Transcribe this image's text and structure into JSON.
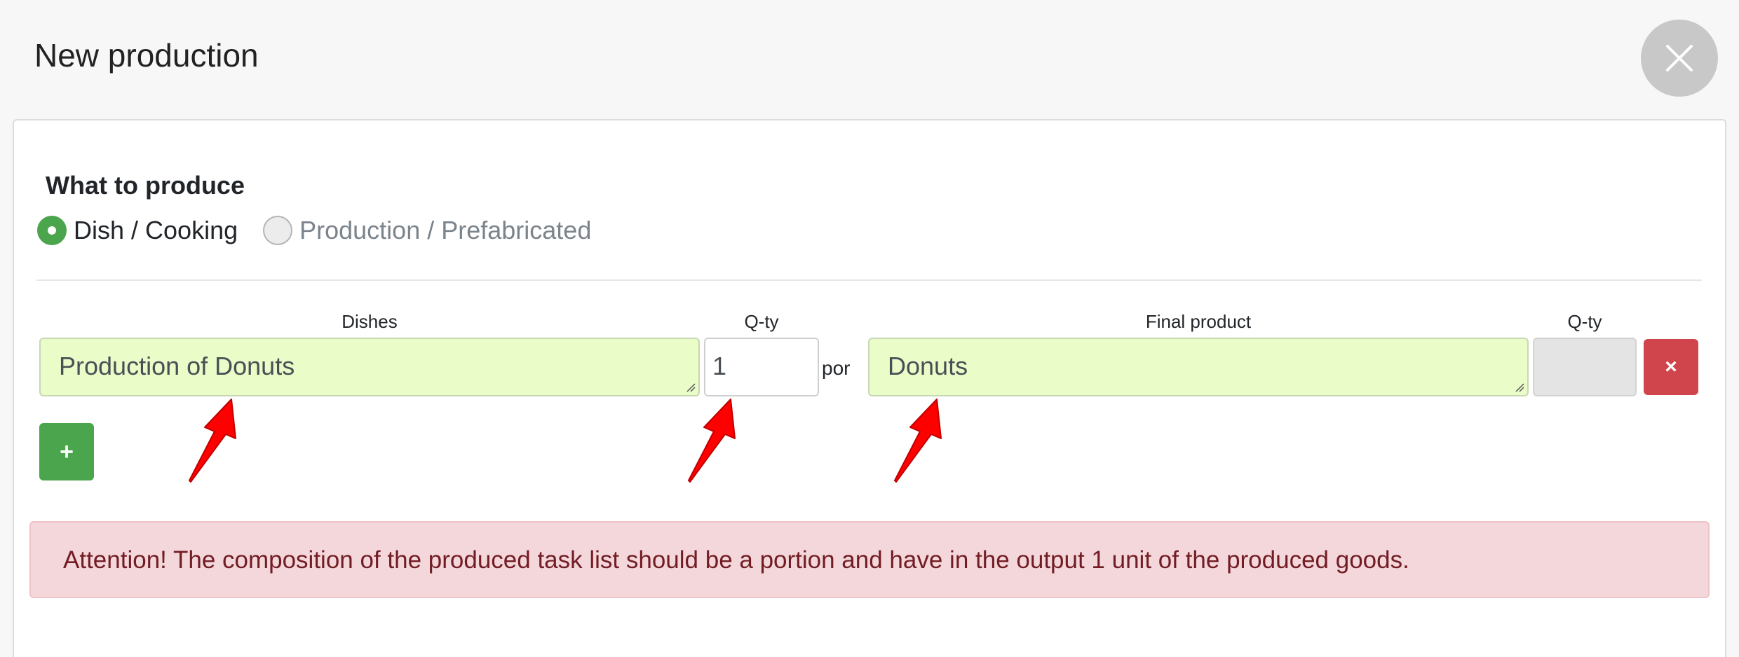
{
  "modal": {
    "title": "New production",
    "close_icon": "close-icon"
  },
  "what_to_produce": {
    "label": "What to produce",
    "options": [
      {
        "label": "Dish / Cooking",
        "selected": true
      },
      {
        "label": "Production / Prefabricated",
        "selected": false
      }
    ]
  },
  "columns": {
    "dishes": "Dishes",
    "qty_left": "Q-ty",
    "final_product": "Final product",
    "qty_right": "Q-ty"
  },
  "row": {
    "dish_value": "Production of Donuts",
    "qty_value": "1",
    "por_label": "por",
    "final_product_value": "Donuts",
    "final_qty_value": "",
    "remove_label": "×"
  },
  "add_button": {
    "label": "+"
  },
  "alert": {
    "text": "Attention! The composition of the produced task list should be a portion and have in the output 1 unit of the produced goods."
  },
  "colors": {
    "accent_green": "#4aa54d",
    "danger_red": "#d0454c",
    "field_bg": "#eafcc8",
    "alert_bg": "#f3d7da",
    "alert_text": "#721c24",
    "annotation_arrow": "#ff0000"
  }
}
